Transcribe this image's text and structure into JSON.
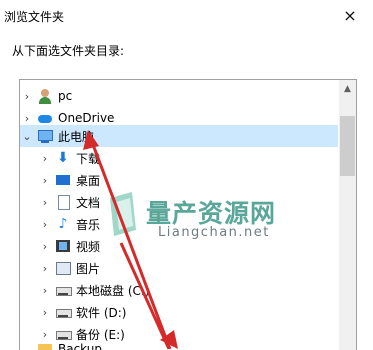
{
  "dialog": {
    "title": "浏览文件夹",
    "close_glyph": "×",
    "prompt": "从下面选文件夹目录:"
  },
  "tree": {
    "items": [
      {
        "label": "pc",
        "icon": "user-icon",
        "chevron": "›"
      },
      {
        "label": "OneDrive",
        "icon": "cloud-icon",
        "chevron": "›"
      },
      {
        "label": "此电脑",
        "icon": "computer-icon",
        "chevron": "⌄",
        "selected": true
      },
      {
        "label": "下载",
        "icon": "download-icon",
        "chevron": "›"
      },
      {
        "label": "桌面",
        "icon": "desktop-icon",
        "chevron": "›"
      },
      {
        "label": "文档",
        "icon": "documents-icon",
        "chevron": "›"
      },
      {
        "label": "音乐",
        "icon": "music-icon",
        "chevron": "›"
      },
      {
        "label": "视频",
        "icon": "videos-icon",
        "chevron": "›"
      },
      {
        "label": "图片",
        "icon": "pictures-icon",
        "chevron": "›"
      },
      {
        "label": "本地磁盘 (C:)",
        "icon": "drive-icon",
        "chevron": "›"
      },
      {
        "label": "软件 (D:)",
        "icon": "drive-icon",
        "chevron": "›"
      },
      {
        "label": "备份 (E:)",
        "icon": "drive-icon",
        "chevron": "›"
      },
      {
        "label": "Backup",
        "icon": "folder-icon",
        "chevron": ""
      }
    ]
  },
  "watermark": {
    "cn": "量产资源网",
    "en": "Liangchan.net"
  },
  "colors": {
    "selection": "#cce8ff",
    "annotation_arrow": "#d42a2a"
  }
}
